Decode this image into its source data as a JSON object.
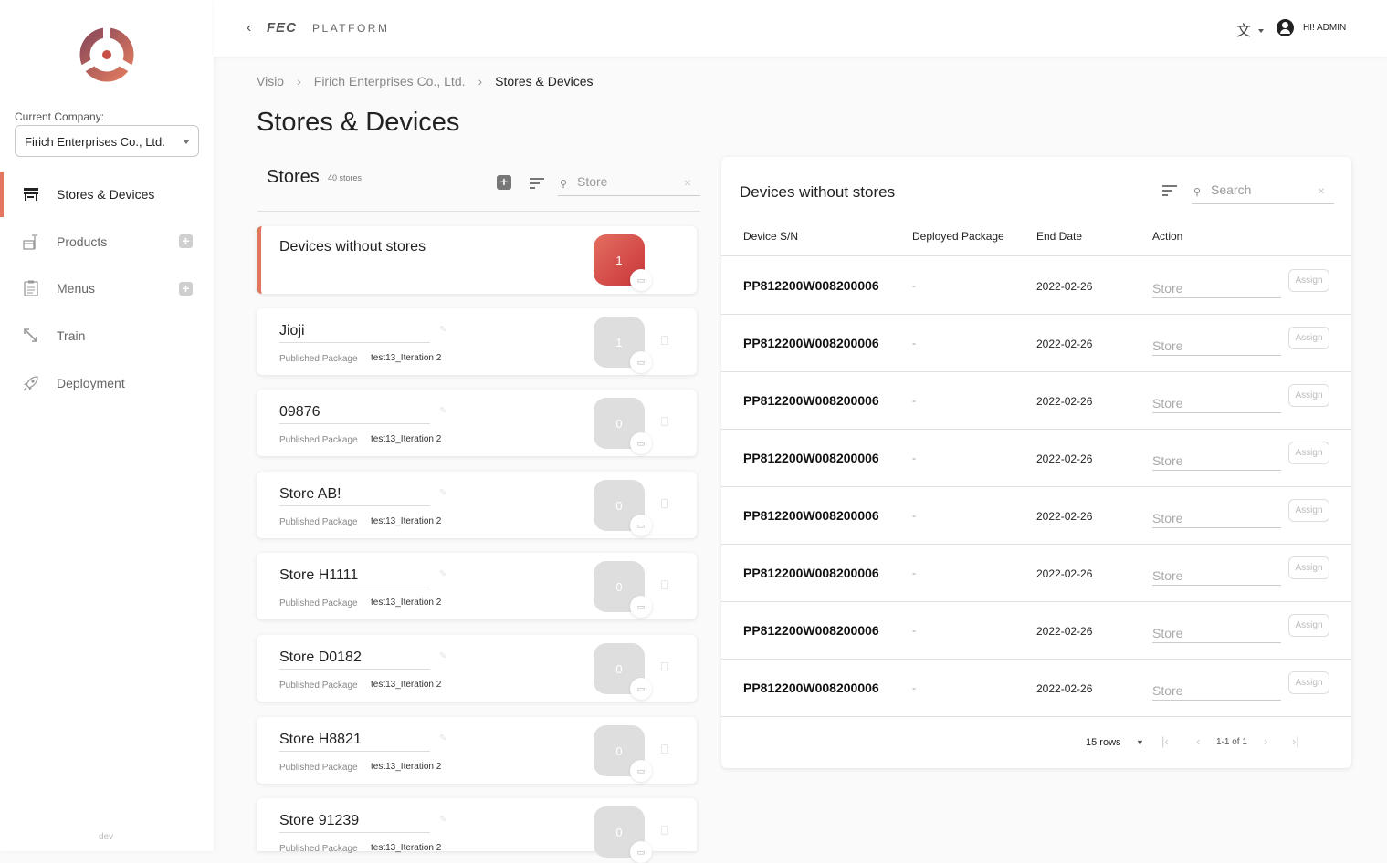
{
  "sidebar": {
    "current_company_label": "Current Company:",
    "company": "Firich Enterprises Co., Ltd.",
    "nav": [
      {
        "label": "Stores & Devices",
        "icon": "storefront-icon",
        "active": true
      },
      {
        "label": "Products",
        "icon": "products-icon",
        "addable": true
      },
      {
        "label": "Menus",
        "icon": "menu-clipboard-icon",
        "addable": true
      },
      {
        "label": "Train",
        "icon": "train-arrow-icon"
      },
      {
        "label": "Deployment",
        "icon": "rocket-icon"
      }
    ],
    "env": "dev"
  },
  "topbar": {
    "brand": "FEC",
    "brand_sub": "PLATFORM",
    "user": "HI! ADMIN"
  },
  "breadcrumb": [
    "Visio",
    "Firich Enterprises Co., Ltd.",
    "Stores & Devices"
  ],
  "page_title": "Stores & Devices",
  "stores": {
    "title": "Stores",
    "count": "40 stores",
    "search_placeholder": "Store",
    "items": [
      {
        "name": "Devices without stores",
        "devices": "1",
        "selected": true
      },
      {
        "name": "Jioji",
        "pkg_label": "Published Package",
        "pkg": "test13_Iteration 2",
        "devices": "1"
      },
      {
        "name": "09876",
        "pkg_label": "Published Package",
        "pkg": "test13_Iteration 2",
        "devices": "0"
      },
      {
        "name": "Store AB!",
        "pkg_label": "Published Package",
        "pkg": "test13_Iteration 2",
        "devices": "0"
      },
      {
        "name": "Store H1111",
        "pkg_label": "Published Package",
        "pkg": "test13_Iteration 2",
        "devices": "0"
      },
      {
        "name": "Store D0182",
        "pkg_label": "Published Package",
        "pkg": "test13_Iteration 2",
        "devices": "0"
      },
      {
        "name": "Store H8821",
        "pkg_label": "Published Package",
        "pkg": "test13_Iteration 2",
        "devices": "0"
      },
      {
        "name": "Store 91239",
        "pkg_label": "Published Package",
        "pkg": "test13_Iteration 2",
        "devices": "0"
      }
    ]
  },
  "devices_panel": {
    "title": "Devices without stores",
    "search_placeholder": "Search",
    "columns": [
      "Device S/N",
      "Deployed Package",
      "End Date",
      "Action"
    ],
    "rows": [
      {
        "sn": "PP812200W008200006",
        "pkg": "-",
        "end": "2022-02-26",
        "store_placeholder": "Store",
        "action": "Assign"
      },
      {
        "sn": "PP812200W008200006",
        "pkg": "-",
        "end": "2022-02-26",
        "store_placeholder": "Store",
        "action": "Assign"
      },
      {
        "sn": "PP812200W008200006",
        "pkg": "-",
        "end": "2022-02-26",
        "store_placeholder": "Store",
        "action": "Assign"
      },
      {
        "sn": "PP812200W008200006",
        "pkg": "-",
        "end": "2022-02-26",
        "store_placeholder": "Store",
        "action": "Assign"
      },
      {
        "sn": "PP812200W008200006",
        "pkg": "-",
        "end": "2022-02-26",
        "store_placeholder": "Store",
        "action": "Assign"
      },
      {
        "sn": "PP812200W008200006",
        "pkg": "-",
        "end": "2022-02-26",
        "store_placeholder": "Store",
        "action": "Assign"
      },
      {
        "sn": "PP812200W008200006",
        "pkg": "-",
        "end": "2022-02-26",
        "store_placeholder": "Store",
        "action": "Assign"
      },
      {
        "sn": "PP812200W008200006",
        "pkg": "-",
        "end": "2022-02-26",
        "store_placeholder": "Store",
        "action": "Assign"
      }
    ],
    "pager": {
      "rows": "15 rows",
      "range": "1-1 of 1"
    }
  },
  "colors": {
    "accent": "#e2765f",
    "badge_hot": "#d94a45"
  }
}
